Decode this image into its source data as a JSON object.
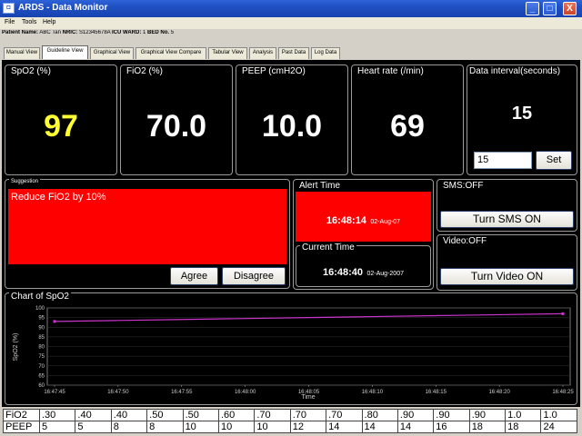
{
  "window": {
    "title": "ARDS - Data Monitor",
    "icon": "app-icon",
    "minimize": "_",
    "maximize": "□",
    "close": "X"
  },
  "menu": [
    "File",
    "Tools",
    "Help"
  ],
  "patient": {
    "name_label": "Patient Name:",
    "name": "ABC Tan",
    "nric_label": "NRIC:",
    "nric": "S12345678A",
    "ward_label": "ICU WARD:",
    "ward": "1",
    "bed_label": "BED No.",
    "bed": "5"
  },
  "tabs": [
    "Manual View",
    "Guideline View",
    "Graphical View",
    "Graphical View Compare",
    "Tabular View",
    "Analysis",
    "Past Data",
    "Log Data"
  ],
  "active_tab": "Guideline View",
  "vitals": {
    "spo2": {
      "label": "SpO2 (%)",
      "value": "97"
    },
    "fio2": {
      "label": "FiO2 (%)",
      "value": "70.0"
    },
    "peep": {
      "label": "PEEP (cmH2O)",
      "value": "10.0"
    },
    "hr": {
      "label": "Heart rate (/min)",
      "value": "69"
    }
  },
  "interval": {
    "label": "Data interval(seconds)",
    "value": "15",
    "input_value": "15",
    "set_label": "Set"
  },
  "suggestion": {
    "label": "Suggestion",
    "text": "Reduce FiO2 by 10%",
    "agree": "Agree",
    "disagree": "Disagree"
  },
  "alert": {
    "label": "Alert Time",
    "time": "16:48:14",
    "date": "02-Aug-07"
  },
  "current": {
    "label": "Current Time",
    "time": "16:48:40",
    "date": "02-Aug-2007"
  },
  "sms": {
    "label": "SMS:OFF",
    "button": "Turn SMS ON"
  },
  "video": {
    "label": "Video:OFF",
    "button": "Turn Video ON"
  },
  "colors": {
    "yellow_value": "#ffff33",
    "alert_red": "#ff0000",
    "series": "#cc33cc"
  },
  "chart_data": {
    "type": "line",
    "title": "Chart of SpO2",
    "xlabel": "Time",
    "ylabel": "SpO2 (%)",
    "x": [
      "16:47:45",
      "16:47:50",
      "16:47:55",
      "16:48:00",
      "16:48:05",
      "16:48:10",
      "16:48:15",
      "16:48:20",
      "16:48:25"
    ],
    "yticks": [
      "100",
      "95",
      "90",
      "85",
      "80",
      "75",
      "70",
      "65",
      "60"
    ],
    "ylim": [
      60,
      100
    ],
    "series": [
      {
        "values": [
          93,
          93.5,
          94,
          94.5,
          95,
          95.5,
          96,
          96.5,
          97
        ]
      }
    ]
  },
  "guideline_table": {
    "rows": [
      {
        "label": "FiO2",
        "cells": [
          ".30",
          ".40",
          ".40",
          ".50",
          ".50",
          ".60",
          ".70",
          ".70",
          ".70",
          ".80",
          ".90",
          ".90",
          ".90",
          "1.0",
          "1.0"
        ]
      },
      {
        "label": "PEEP",
        "cells": [
          "5",
          "5",
          "8",
          "8",
          "10",
          "10",
          "10",
          "12",
          "14",
          "14",
          "14",
          "16",
          "18",
          "18",
          "24"
        ]
      }
    ]
  }
}
